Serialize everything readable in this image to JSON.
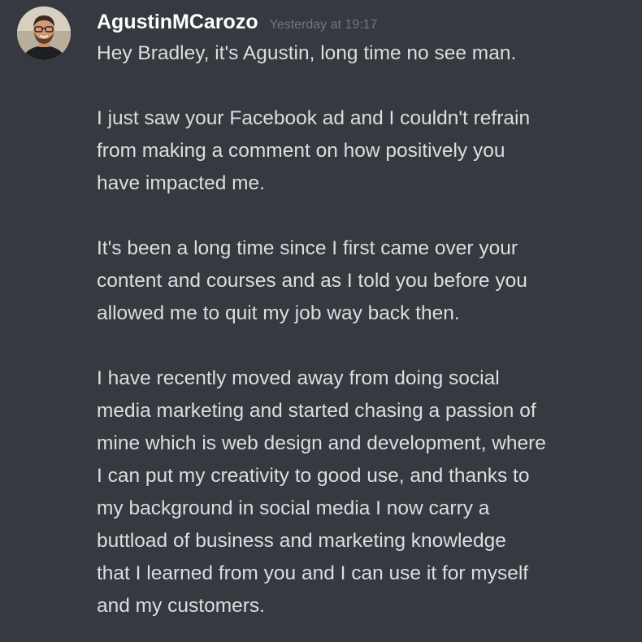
{
  "message": {
    "username": "AgustinMCarozo",
    "timestamp": "Yesterday at 19:17",
    "paragraphs": [
      "Hey Bradley, it's Agustin, long time no see man.",
      "I just saw your Facebook ad and I couldn't refrain\nfrom making a comment on how positively you\nhave impacted me.",
      "It's been a long time since I first came over your\ncontent and courses and as I told you before you\nallowed me to quit my job way back then.",
      "I have recently moved away from doing social\nmedia marketing and started chasing a passion of\nmine which is web design and development, where\nI can put my creativity to good use,  and thanks to\nmy background in social media I now carry a\nbuttload of business and marketing knowledge\nthat I learned from you and I can use it for myself\nand my customers."
    ]
  },
  "colors": {
    "background": "#36393f",
    "username": "#ffffff",
    "timestamp": "#72767d",
    "text": "#dcddde"
  },
  "icons": {
    "avatar": "user-avatar-photo"
  }
}
